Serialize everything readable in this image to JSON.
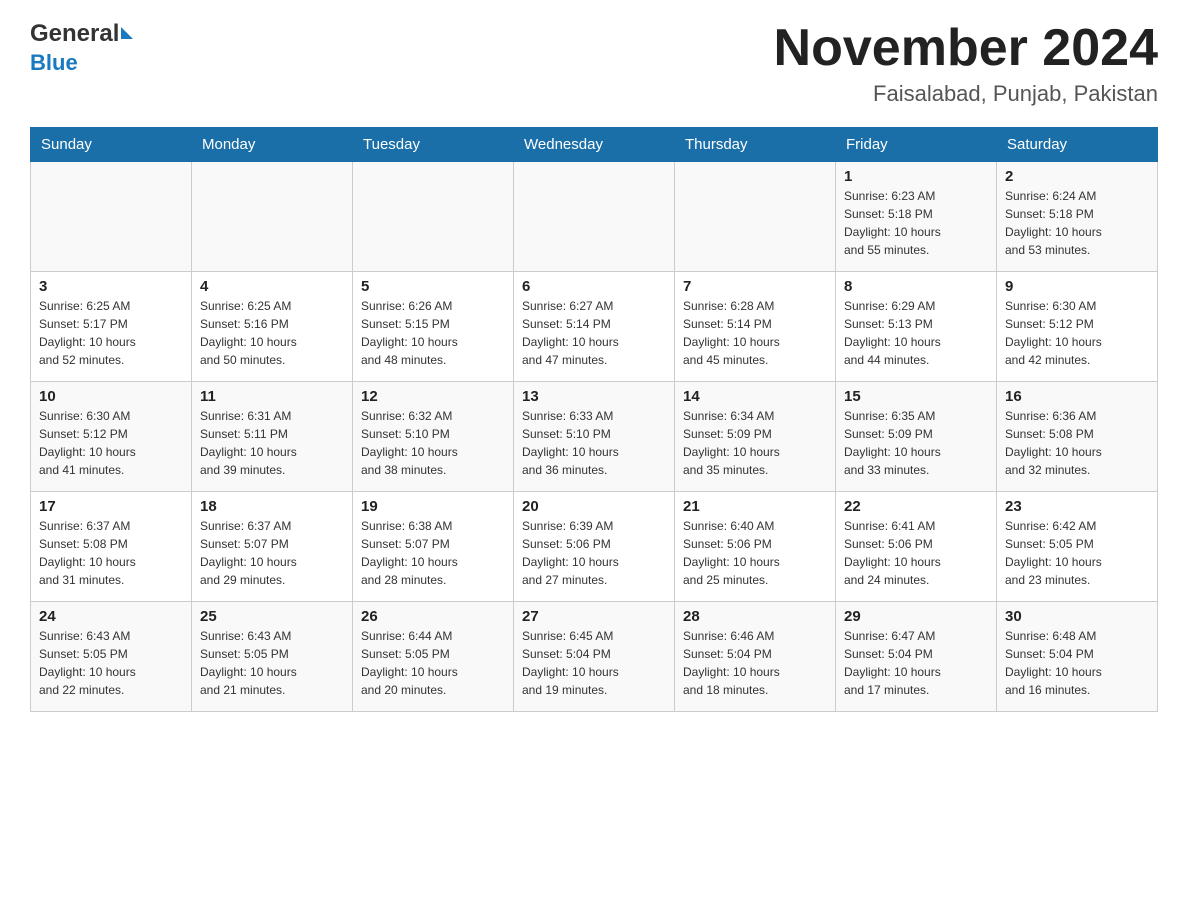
{
  "header": {
    "logo_text_general": "General",
    "logo_text_blue": "Blue",
    "main_title": "November 2024",
    "subtitle": "Faisalabad, Punjab, Pakistan"
  },
  "calendar": {
    "days_of_week": [
      "Sunday",
      "Monday",
      "Tuesday",
      "Wednesday",
      "Thursday",
      "Friday",
      "Saturday"
    ],
    "weeks": [
      [
        {
          "day": "",
          "info": ""
        },
        {
          "day": "",
          "info": ""
        },
        {
          "day": "",
          "info": ""
        },
        {
          "day": "",
          "info": ""
        },
        {
          "day": "",
          "info": ""
        },
        {
          "day": "1",
          "info": "Sunrise: 6:23 AM\nSunset: 5:18 PM\nDaylight: 10 hours\nand 55 minutes."
        },
        {
          "day": "2",
          "info": "Sunrise: 6:24 AM\nSunset: 5:18 PM\nDaylight: 10 hours\nand 53 minutes."
        }
      ],
      [
        {
          "day": "3",
          "info": "Sunrise: 6:25 AM\nSunset: 5:17 PM\nDaylight: 10 hours\nand 52 minutes."
        },
        {
          "day": "4",
          "info": "Sunrise: 6:25 AM\nSunset: 5:16 PM\nDaylight: 10 hours\nand 50 minutes."
        },
        {
          "day": "5",
          "info": "Sunrise: 6:26 AM\nSunset: 5:15 PM\nDaylight: 10 hours\nand 48 minutes."
        },
        {
          "day": "6",
          "info": "Sunrise: 6:27 AM\nSunset: 5:14 PM\nDaylight: 10 hours\nand 47 minutes."
        },
        {
          "day": "7",
          "info": "Sunrise: 6:28 AM\nSunset: 5:14 PM\nDaylight: 10 hours\nand 45 minutes."
        },
        {
          "day": "8",
          "info": "Sunrise: 6:29 AM\nSunset: 5:13 PM\nDaylight: 10 hours\nand 44 minutes."
        },
        {
          "day": "9",
          "info": "Sunrise: 6:30 AM\nSunset: 5:12 PM\nDaylight: 10 hours\nand 42 minutes."
        }
      ],
      [
        {
          "day": "10",
          "info": "Sunrise: 6:30 AM\nSunset: 5:12 PM\nDaylight: 10 hours\nand 41 minutes."
        },
        {
          "day": "11",
          "info": "Sunrise: 6:31 AM\nSunset: 5:11 PM\nDaylight: 10 hours\nand 39 minutes."
        },
        {
          "day": "12",
          "info": "Sunrise: 6:32 AM\nSunset: 5:10 PM\nDaylight: 10 hours\nand 38 minutes."
        },
        {
          "day": "13",
          "info": "Sunrise: 6:33 AM\nSunset: 5:10 PM\nDaylight: 10 hours\nand 36 minutes."
        },
        {
          "day": "14",
          "info": "Sunrise: 6:34 AM\nSunset: 5:09 PM\nDaylight: 10 hours\nand 35 minutes."
        },
        {
          "day": "15",
          "info": "Sunrise: 6:35 AM\nSunset: 5:09 PM\nDaylight: 10 hours\nand 33 minutes."
        },
        {
          "day": "16",
          "info": "Sunrise: 6:36 AM\nSunset: 5:08 PM\nDaylight: 10 hours\nand 32 minutes."
        }
      ],
      [
        {
          "day": "17",
          "info": "Sunrise: 6:37 AM\nSunset: 5:08 PM\nDaylight: 10 hours\nand 31 minutes."
        },
        {
          "day": "18",
          "info": "Sunrise: 6:37 AM\nSunset: 5:07 PM\nDaylight: 10 hours\nand 29 minutes."
        },
        {
          "day": "19",
          "info": "Sunrise: 6:38 AM\nSunset: 5:07 PM\nDaylight: 10 hours\nand 28 minutes."
        },
        {
          "day": "20",
          "info": "Sunrise: 6:39 AM\nSunset: 5:06 PM\nDaylight: 10 hours\nand 27 minutes."
        },
        {
          "day": "21",
          "info": "Sunrise: 6:40 AM\nSunset: 5:06 PM\nDaylight: 10 hours\nand 25 minutes."
        },
        {
          "day": "22",
          "info": "Sunrise: 6:41 AM\nSunset: 5:06 PM\nDaylight: 10 hours\nand 24 minutes."
        },
        {
          "day": "23",
          "info": "Sunrise: 6:42 AM\nSunset: 5:05 PM\nDaylight: 10 hours\nand 23 minutes."
        }
      ],
      [
        {
          "day": "24",
          "info": "Sunrise: 6:43 AM\nSunset: 5:05 PM\nDaylight: 10 hours\nand 22 minutes."
        },
        {
          "day": "25",
          "info": "Sunrise: 6:43 AM\nSunset: 5:05 PM\nDaylight: 10 hours\nand 21 minutes."
        },
        {
          "day": "26",
          "info": "Sunrise: 6:44 AM\nSunset: 5:05 PM\nDaylight: 10 hours\nand 20 minutes."
        },
        {
          "day": "27",
          "info": "Sunrise: 6:45 AM\nSunset: 5:04 PM\nDaylight: 10 hours\nand 19 minutes."
        },
        {
          "day": "28",
          "info": "Sunrise: 6:46 AM\nSunset: 5:04 PM\nDaylight: 10 hours\nand 18 minutes."
        },
        {
          "day": "29",
          "info": "Sunrise: 6:47 AM\nSunset: 5:04 PM\nDaylight: 10 hours\nand 17 minutes."
        },
        {
          "day": "30",
          "info": "Sunrise: 6:48 AM\nSunset: 5:04 PM\nDaylight: 10 hours\nand 16 minutes."
        }
      ]
    ]
  }
}
